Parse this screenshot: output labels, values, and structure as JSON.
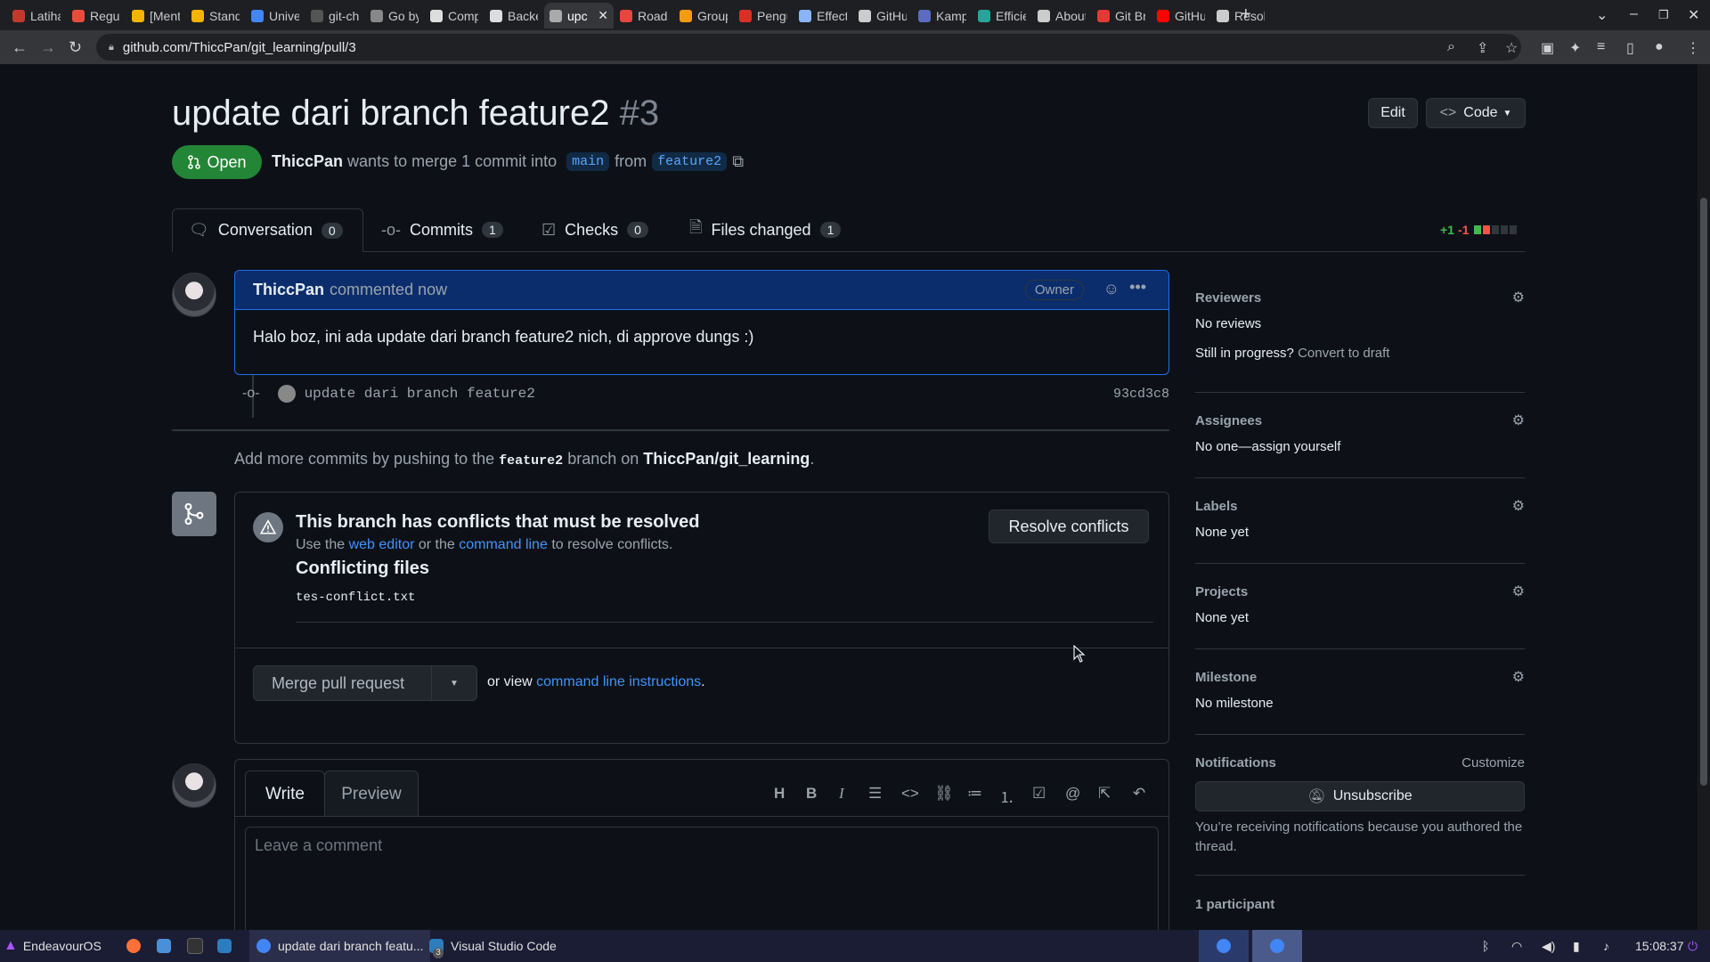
{
  "browser": {
    "tabs": [
      {
        "label": "Latiha",
        "color": "#c0392b"
      },
      {
        "label": "Regule",
        "color": "#e74c3c"
      },
      {
        "label": "[Ment",
        "color": "#f4b400"
      },
      {
        "label": "Standa",
        "color": "#f4b400"
      },
      {
        "label": "Univer",
        "color": "#4285f4"
      },
      {
        "label": "git-che",
        "color": "#555"
      },
      {
        "label": "Go by",
        "color": "#888"
      },
      {
        "label": "Comp",
        "color": "#ddd"
      },
      {
        "label": "Backer",
        "color": "#ddd"
      },
      {
        "label": "upc",
        "color": "#aaa",
        "active": true
      },
      {
        "label": "Roadn",
        "color": "#e8453c"
      },
      {
        "label": "Group",
        "color": "#f39c12"
      },
      {
        "label": "Pengu",
        "color": "#d93025"
      },
      {
        "label": "Effecti",
        "color": "#8ab4f8"
      },
      {
        "label": "GitHul",
        "color": "#ccc"
      },
      {
        "label": "Kamp",
        "color": "#5c6bc0"
      },
      {
        "label": "Efficien",
        "color": "#26a69a"
      },
      {
        "label": "About",
        "color": "#ccc"
      },
      {
        "label": "Git Bra",
        "color": "#e53935"
      },
      {
        "label": "GitHul",
        "color": "#ff0000"
      },
      {
        "label": "Resolv",
        "color": "#ccc"
      }
    ],
    "url": "github.com/ThiccPan/git_learning/pull/3"
  },
  "pr": {
    "title": "update dari branch feature2",
    "number": "#3",
    "state": "Open",
    "author": "ThiccPan",
    "meta_text": "wants to merge 1 commit into",
    "base_branch": "main",
    "from_text": "from",
    "head_branch": "feature2",
    "edit_label": "Edit",
    "code_label": "Code"
  },
  "tabs": [
    {
      "label": "Conversation",
      "count": "0"
    },
    {
      "label": "Commits",
      "count": "1"
    },
    {
      "label": "Checks",
      "count": "0"
    },
    {
      "label": "Files changed",
      "count": "1"
    }
  ],
  "diffstat": {
    "additions": "+1",
    "deletions": "-1"
  },
  "comment": {
    "author": "ThiccPan",
    "action": "commented now",
    "role": "Owner",
    "body": "Halo boz, ini ada update dari branch feature2 nich, di approve dungs :)"
  },
  "commit": {
    "message": "update dari branch feature2",
    "sha": "93cd3c8"
  },
  "add_commits": {
    "prefix": "Add more commits by pushing to the",
    "branch": "feature2",
    "middle": "branch on",
    "repo": "ThiccPan/git_learning",
    "suffix": "."
  },
  "merge": {
    "conflict_title": "This branch has conflicts that must be resolved",
    "use_the": "Use the",
    "web_editor": "web editor",
    "or_the": "or the",
    "command_line": "command line",
    "to_resolve": "to resolve conflicts.",
    "resolve_button": "Resolve conflicts",
    "conflicting_files_title": "Conflicting files",
    "files": [
      "tes-conflict.txt"
    ],
    "merge_button": "Merge pull request",
    "or_view": "or view",
    "cli_instructions": "command line instructions",
    "period": "."
  },
  "editor": {
    "write_tab": "Write",
    "preview_tab": "Preview",
    "placeholder": "Leave a comment"
  },
  "sidebar": {
    "reviewers": {
      "title": "Reviewers",
      "value": "No reviews",
      "in_progress": "Still in progress?",
      "convert": "Convert to draft"
    },
    "assignees": {
      "title": "Assignees",
      "value_prefix": "No one—",
      "assign": "assign yourself"
    },
    "labels": {
      "title": "Labels",
      "value": "None yet"
    },
    "projects": {
      "title": "Projects",
      "value": "None yet"
    },
    "milestone": {
      "title": "Milestone",
      "value": "No milestone"
    },
    "notifications": {
      "title": "Notifications",
      "customize": "Customize",
      "unsubscribe": "Unsubscribe",
      "note": "You’re receiving notifications because you authored the thread."
    },
    "participants": {
      "title": "1 participant"
    }
  },
  "taskbar": {
    "os_label": "EndeavourOS",
    "window1": "update dari branch featu...",
    "window2": "Visual Studio Code",
    "window2_badge": "3",
    "clock": "15:08:37"
  }
}
